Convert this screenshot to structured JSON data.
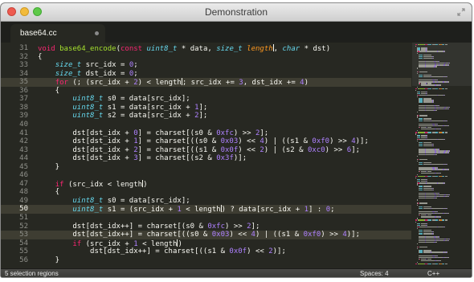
{
  "window": {
    "title": "Demonstration"
  },
  "tab": {
    "label": "base64.cc"
  },
  "editor": {
    "current_line": 50,
    "highlighted_lines": [
      35,
      50,
      53
    ],
    "lines": [
      {
        "n": 31,
        "t": [
          [
            "void",
            "k"
          ],
          [
            " "
          ],
          [
            "base64_encode",
            "f"
          ],
          [
            "("
          ],
          [
            "const",
            "k"
          ],
          [
            " "
          ],
          [
            "uint8_t",
            "t"
          ],
          [
            " * data, "
          ],
          [
            "size_t",
            "t"
          ],
          [
            " "
          ],
          [
            "length",
            "p"
          ],
          [
            "|",
            "c"
          ],
          [
            ", "
          ],
          [
            "char",
            "t"
          ],
          [
            " * dst)"
          ]
        ]
      },
      {
        "n": 32,
        "t": [
          [
            "{"
          ]
        ]
      },
      {
        "n": 33,
        "t": [
          [
            "    "
          ],
          [
            "size_t",
            "t"
          ],
          [
            " src_idx = "
          ],
          [
            "0",
            "n"
          ],
          [
            ";"
          ]
        ]
      },
      {
        "n": 34,
        "t": [
          [
            "    "
          ],
          [
            "size_t",
            "t"
          ],
          [
            " dst_idx = "
          ],
          [
            "0",
            "n"
          ],
          [
            ";"
          ]
        ]
      },
      {
        "n": 35,
        "t": [
          [
            "    "
          ],
          [
            "for",
            "k"
          ],
          [
            " (; (src_idx + "
          ],
          [
            "2",
            "n"
          ],
          [
            ") < length"
          ],
          [
            "|",
            "c"
          ],
          [
            "; src_idx += "
          ],
          [
            "3",
            "n"
          ],
          [
            ", dst_idx += "
          ],
          [
            "4",
            "n"
          ],
          [
            ")"
          ]
        ]
      },
      {
        "n": 36,
        "t": [
          [
            "    {"
          ]
        ]
      },
      {
        "n": 37,
        "t": [
          [
            "        "
          ],
          [
            "uint8_t",
            "t"
          ],
          [
            " s0 = data[src_idx];"
          ]
        ]
      },
      {
        "n": 38,
        "t": [
          [
            "        "
          ],
          [
            "uint8_t",
            "t"
          ],
          [
            " s1 = data[src_idx + "
          ],
          [
            "1",
            "n"
          ],
          [
            "];"
          ]
        ]
      },
      {
        "n": 39,
        "t": [
          [
            "        "
          ],
          [
            "uint8_t",
            "t"
          ],
          [
            " s2 = data[src_idx + "
          ],
          [
            "2",
            "n"
          ],
          [
            "];"
          ]
        ]
      },
      {
        "n": 40,
        "t": []
      },
      {
        "n": 41,
        "t": [
          [
            "        dst[dst_idx + "
          ],
          [
            "0",
            "n"
          ],
          [
            "] = charset[(s0 & "
          ],
          [
            "0xfc",
            "n"
          ],
          [
            ") >> "
          ],
          [
            "2",
            "n"
          ],
          [
            "];"
          ]
        ]
      },
      {
        "n": 42,
        "t": [
          [
            "        dst[dst_idx + "
          ],
          [
            "1",
            "n"
          ],
          [
            "] = charset[((s0 & "
          ],
          [
            "0x03",
            "n"
          ],
          [
            ") << "
          ],
          [
            "4",
            "n"
          ],
          [
            ") | ((s1 & "
          ],
          [
            "0xf0",
            "n"
          ],
          [
            ") >> "
          ],
          [
            "4",
            "n"
          ],
          [
            ")];"
          ]
        ]
      },
      {
        "n": 43,
        "t": [
          [
            "        dst[dst_idx + "
          ],
          [
            "2",
            "n"
          ],
          [
            "] = charset[((s1 & "
          ],
          [
            "0x0f",
            "n"
          ],
          [
            ") << "
          ],
          [
            "2",
            "n"
          ],
          [
            ") | (s2 & "
          ],
          [
            "0xc0",
            "n"
          ],
          [
            ") >> "
          ],
          [
            "6",
            "n"
          ],
          [
            "];"
          ]
        ]
      },
      {
        "n": 44,
        "t": [
          [
            "        dst[dst_idx + "
          ],
          [
            "3",
            "n"
          ],
          [
            "] = charset[(s2 & "
          ],
          [
            "0x3f",
            "n"
          ],
          [
            ")];"
          ]
        ]
      },
      {
        "n": 45,
        "t": [
          [
            "    }"
          ]
        ]
      },
      {
        "n": 46,
        "t": []
      },
      {
        "n": 47,
        "t": [
          [
            "    "
          ],
          [
            "if",
            "k"
          ],
          [
            " (src_idx < length"
          ],
          [
            "|",
            "c"
          ],
          [
            ")"
          ]
        ]
      },
      {
        "n": 48,
        "t": [
          [
            "    {"
          ]
        ]
      },
      {
        "n": 49,
        "t": [
          [
            "        "
          ],
          [
            "uint8_t",
            "t"
          ],
          [
            " s0 = data[src_idx];"
          ]
        ]
      },
      {
        "n": 50,
        "t": [
          [
            "        "
          ],
          [
            "uint8_t",
            "t"
          ],
          [
            " s1 = (src_idx + "
          ],
          [
            "1",
            "n"
          ],
          [
            " < length"
          ],
          [
            "|",
            "c"
          ],
          [
            ") ? data[src_idx + "
          ],
          [
            "1",
            "n"
          ],
          [
            "] : "
          ],
          [
            "0",
            "n"
          ],
          [
            ";"
          ]
        ]
      },
      {
        "n": 51,
        "t": []
      },
      {
        "n": 52,
        "t": [
          [
            "        dst[dst_idx++] = charset[(s0 & "
          ],
          [
            "0xfc",
            "n"
          ],
          [
            ") >> "
          ],
          [
            "2",
            "n"
          ],
          [
            "];"
          ]
        ]
      },
      {
        "n": 53,
        "t": [
          [
            "        dst[dst_idx++] = charset[((s0 & "
          ],
          [
            "0x03",
            "n"
          ],
          [
            ") << "
          ],
          [
            "4",
            "n"
          ],
          [
            ") | ((s1 & "
          ],
          [
            "0xf0",
            "n"
          ],
          [
            ") >> "
          ],
          [
            "4",
            "n"
          ],
          [
            ")];"
          ]
        ]
      },
      {
        "n": 54,
        "t": [
          [
            "        "
          ],
          [
            "if",
            "k"
          ],
          [
            " (src_idx + "
          ],
          [
            "1",
            "n"
          ],
          [
            " < length"
          ],
          [
            "|",
            "c"
          ],
          [
            ")"
          ]
        ]
      },
      {
        "n": 55,
        "t": [
          [
            "            dst[dst_idx++] = charset[((s1 & "
          ],
          [
            "0x0f",
            "n"
          ],
          [
            ") << "
          ],
          [
            "2",
            "n"
          ],
          [
            ")];"
          ]
        ]
      },
      {
        "n": 56,
        "t": [
          [
            "    }"
          ]
        ]
      }
    ]
  },
  "colors": {
    "background": "#272822",
    "keyword": "#f92672",
    "type": "#66d9ef",
    "function": "#a6e22e",
    "parameter": "#fd971f",
    "number": "#ae81ff",
    "text": "#f8f8f2",
    "line_highlight": "#3e3d32"
  },
  "statusbar": {
    "selection": "5 selection regions",
    "indentation": "Spaces: 4",
    "syntax": "C++"
  }
}
